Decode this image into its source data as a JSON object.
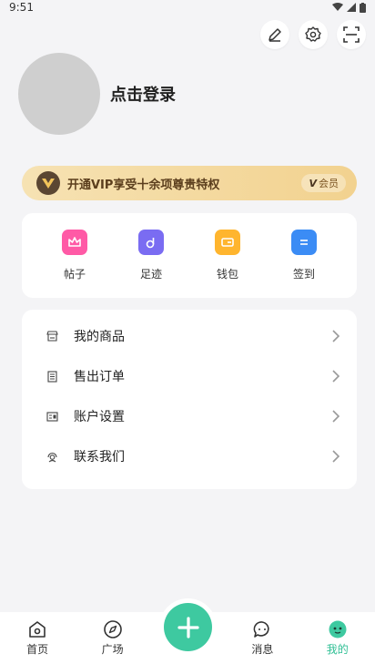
{
  "status_bar": {
    "time": "9:51"
  },
  "profile": {
    "login_prompt": "点击登录"
  },
  "vip": {
    "banner_text": "开通VIP享受十余项尊贵特权",
    "badge_v": "V",
    "badge_label": "会员"
  },
  "quick_actions": [
    {
      "label": "帖子",
      "icon": "crown-icon",
      "color": "#ff5aa6"
    },
    {
      "label": "足迹",
      "icon": "footprint-icon",
      "color": "#7a6cf2"
    },
    {
      "label": "钱包",
      "icon": "wallet-icon",
      "color": "#ffb52e"
    },
    {
      "label": "签到",
      "icon": "checkin-icon",
      "color": "#3b8cf5"
    }
  ],
  "menu": [
    {
      "label": "我的商品",
      "icon": "store-icon"
    },
    {
      "label": "售出订单",
      "icon": "order-icon"
    },
    {
      "label": "账户设置",
      "icon": "account-icon"
    },
    {
      "label": "联系我们",
      "icon": "support-icon"
    }
  ],
  "nav": [
    {
      "label": "首页",
      "icon": "home-icon"
    },
    {
      "label": "广场",
      "icon": "compass-icon"
    },
    {
      "label": "消息",
      "icon": "message-icon"
    },
    {
      "label": "我的",
      "icon": "profile-icon"
    }
  ],
  "colors": {
    "accent": "#3ec9a0",
    "vip_gold": "#f2d28f"
  }
}
